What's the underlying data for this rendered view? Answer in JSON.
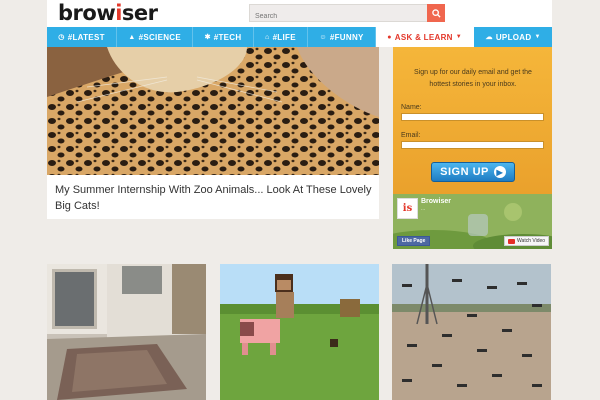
{
  "header": {
    "logo_start": "brow",
    "logo_i": "i",
    "logo_end": "ser",
    "search_placeholder": "Search"
  },
  "nav": {
    "items": [
      {
        "icon": "clock-icon",
        "label": "#LATEST"
      },
      {
        "icon": "flask-icon",
        "label": "#SCIENCE"
      },
      {
        "icon": "gear-icon",
        "label": "#TECH"
      },
      {
        "icon": "home-icon",
        "label": "#LIFE"
      },
      {
        "icon": "smiley-icon",
        "label": "#FUNNY"
      },
      {
        "icon": "comment-icon",
        "label": "ASK & LEARN"
      },
      {
        "icon": "cloud-upload-icon",
        "label": "UPLOAD"
      }
    ],
    "active_index": 5
  },
  "feature": {
    "title": "My Summer Internship With Zoo Animals... Look At These Lovely Big Cats!"
  },
  "signup": {
    "text": "Sign up for our daily email and get the hottest stories in your inbox.",
    "name_label": "Name:",
    "email_label": "Email:",
    "button_label": "SIGN UP"
  },
  "facebook_widget": {
    "page_name": "Browiser",
    "page_sub": "...",
    "like_label": "Like Page",
    "watch_label": "Watch Video"
  },
  "colors": {
    "nav_blue": "#2faee6",
    "accent_red": "#e3372a",
    "signup_orange": "#f5b63a",
    "search_button": "#f0664e"
  }
}
